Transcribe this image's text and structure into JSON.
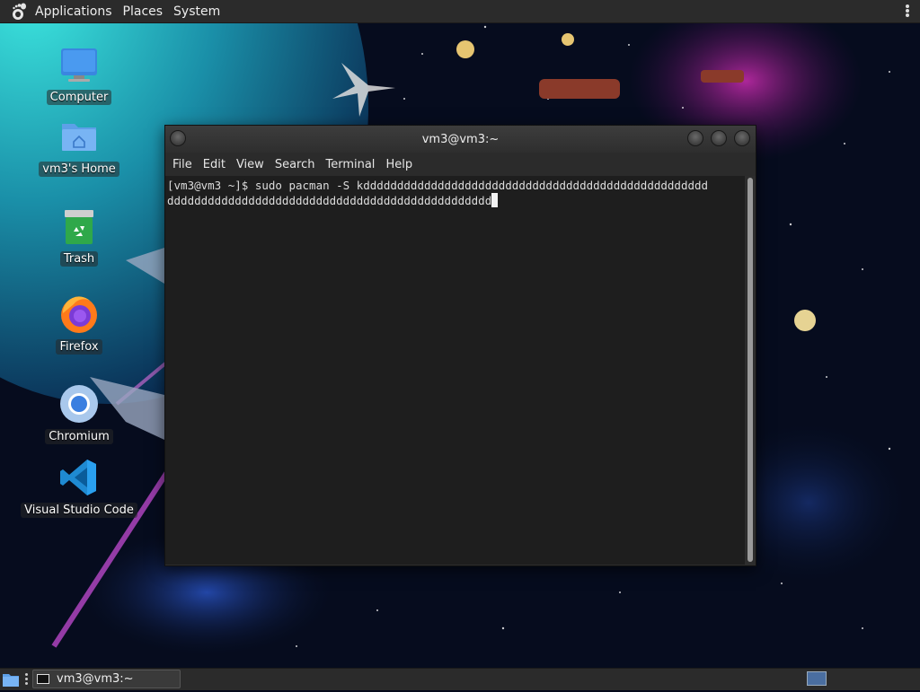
{
  "top_panel": {
    "menus": [
      "Applications",
      "Places",
      "System"
    ]
  },
  "desktop_icons": [
    {
      "label": "Computer",
      "icon": "computer-icon"
    },
    {
      "label": "vm3's Home",
      "icon": "home-folder-icon"
    },
    {
      "label": "Trash",
      "icon": "trash-icon"
    },
    {
      "label": "Firefox",
      "icon": "firefox-icon"
    },
    {
      "label": "Chromium",
      "icon": "chromium-icon"
    },
    {
      "label": "Visual Studio Code",
      "icon": "vscode-icon"
    }
  ],
  "terminal": {
    "title": "vm3@vm3:~",
    "menu": [
      "File",
      "Edit",
      "View",
      "Search",
      "Terminal",
      "Help"
    ],
    "lines": [
      "[vm3@vm3 ~]$ sudo pacman -S kddddddddddddddddddddddddddddddddddddddddddddddddddd",
      "dddddddddddddddddddddddddddddddddddddddddddddddd"
    ]
  },
  "bottom_panel": {
    "task_label": "vm3@vm3:~"
  },
  "colors": {
    "panel": "#2b2b2b",
    "terminal_bg": "#1e1e1e",
    "terminal_fg": "#dcdcdc"
  }
}
